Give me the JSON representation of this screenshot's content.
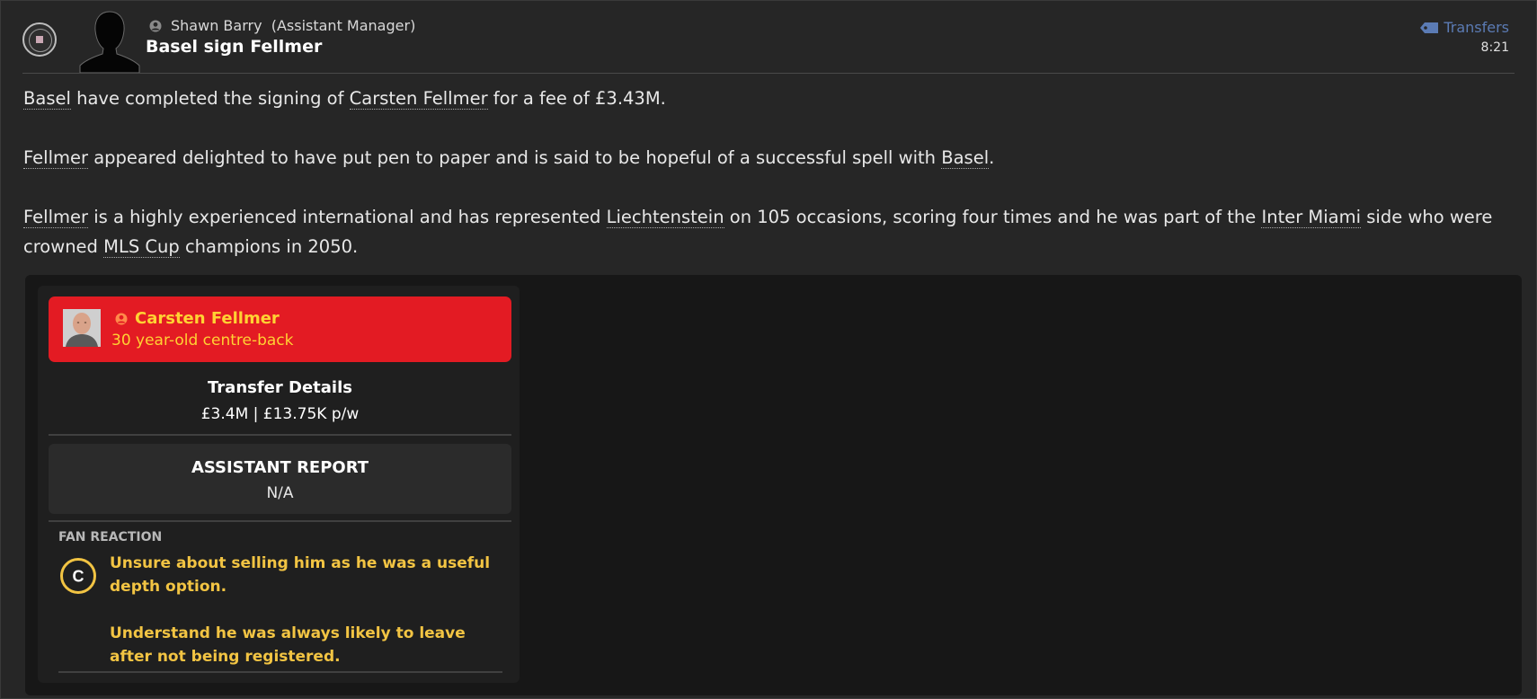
{
  "header": {
    "sender_name": "Shawn Barry  (Assistant Manager)",
    "headline": "Basel sign Fellmer",
    "category": "Transfers",
    "time": "8:21"
  },
  "body": {
    "p1": {
      "a": "Basel",
      "b": " have completed the signing of ",
      "c": "Carsten Fellmer",
      "d": " for a fee of £3.43M."
    },
    "p2": {
      "a": "Fellmer",
      "b": " appeared delighted to have put pen to paper and is said to be hopeful of a successful spell with ",
      "c": "Basel",
      "d": "."
    },
    "p3": {
      "a": "Fellmer",
      "b": " is a highly experienced international and has represented ",
      "c": "Liechtenstein",
      "d": " on 105 occasions, scoring four times and he was part of the ",
      "e": "Inter Miami",
      "f": " side who were crowned ",
      "g": "MLS Cup",
      "h": " champions in 2050."
    }
  },
  "card": {
    "player_name": "Carsten Fellmer",
    "player_desc": "30 year-old centre-back",
    "transfer_title": "Transfer Details",
    "transfer_value": "£3.4M | £13.75K p/w",
    "report_title": "ASSISTANT REPORT",
    "report_value": "N/A",
    "fan_title": "FAN REACTION",
    "fan_grade": "C",
    "fan_line1": "Unsure about selling him as he was a useful depth option.",
    "fan_line2": "Understand he was always likely to leave after not being registered."
  },
  "colors": {
    "player_banner": "#e31b23",
    "player_text": "#ffd233",
    "fan_text": "#f2c443",
    "category": "#5b7bb4"
  },
  "icons": {
    "club": "club-badge-icon",
    "sender": "person-icon",
    "category": "tag-icon",
    "grade": "grade-c-icon"
  }
}
